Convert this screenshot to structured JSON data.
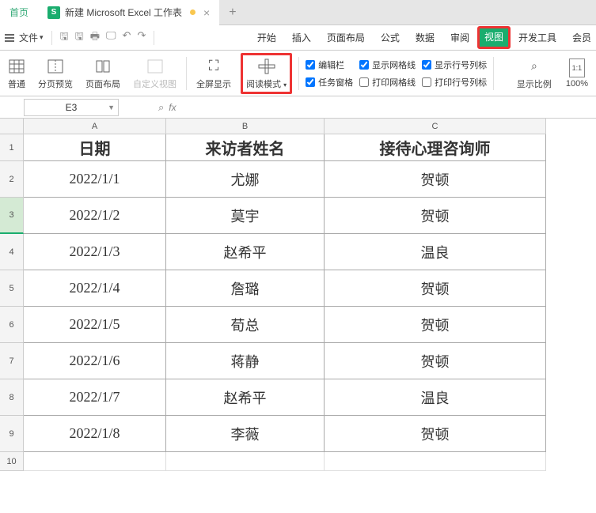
{
  "tabs": {
    "home": "首页",
    "doc": "新建 Microsoft Excel 工作表"
  },
  "menu": {
    "file": "文件",
    "start": "开始",
    "insert": "插入",
    "layout": "页面布局",
    "formula": "公式",
    "data": "数据",
    "review": "审阅",
    "view": "视图",
    "dev": "开发工具",
    "member": "会员"
  },
  "ribbon": {
    "normal": "普通",
    "pagebreak": "分页预览",
    "pagelayout": "页面布局",
    "custom": "自定义视图",
    "fullscreen": "全屏显示",
    "readmode": "阅读模式",
    "chk_editbar": "编辑栏",
    "chk_taskpane": "任务窗格",
    "chk_showgrid": "显示网格线",
    "chk_printgrid": "打印网格线",
    "chk_showrc": "显示行号列标",
    "chk_printrc": "打印行号列标",
    "zoomratio": "显示比例",
    "pct": "100%"
  },
  "cellref": "E3",
  "cols": [
    "A",
    "B",
    "C"
  ],
  "header": [
    "日期",
    "来访者姓名",
    "接待心理咨询师"
  ],
  "rows": [
    [
      "2022/1/1",
      "尤娜",
      "贺顿"
    ],
    [
      "2022/1/2",
      "莫宇",
      "贺顿"
    ],
    [
      "2022/1/3",
      "赵希平",
      "温良"
    ],
    [
      "2022/1/4",
      "詹璐",
      "贺顿"
    ],
    [
      "2022/1/5",
      "荀总",
      "贺顿"
    ],
    [
      "2022/1/6",
      "蒋静",
      "贺顿"
    ],
    [
      "2022/1/7",
      "赵希平",
      "温良"
    ],
    [
      "2022/1/8",
      "李薇",
      "贺顿"
    ]
  ],
  "chk_states": {
    "editbar": true,
    "taskpane": true,
    "showgrid": true,
    "printgrid": false,
    "showrc": true,
    "printrc": false
  }
}
